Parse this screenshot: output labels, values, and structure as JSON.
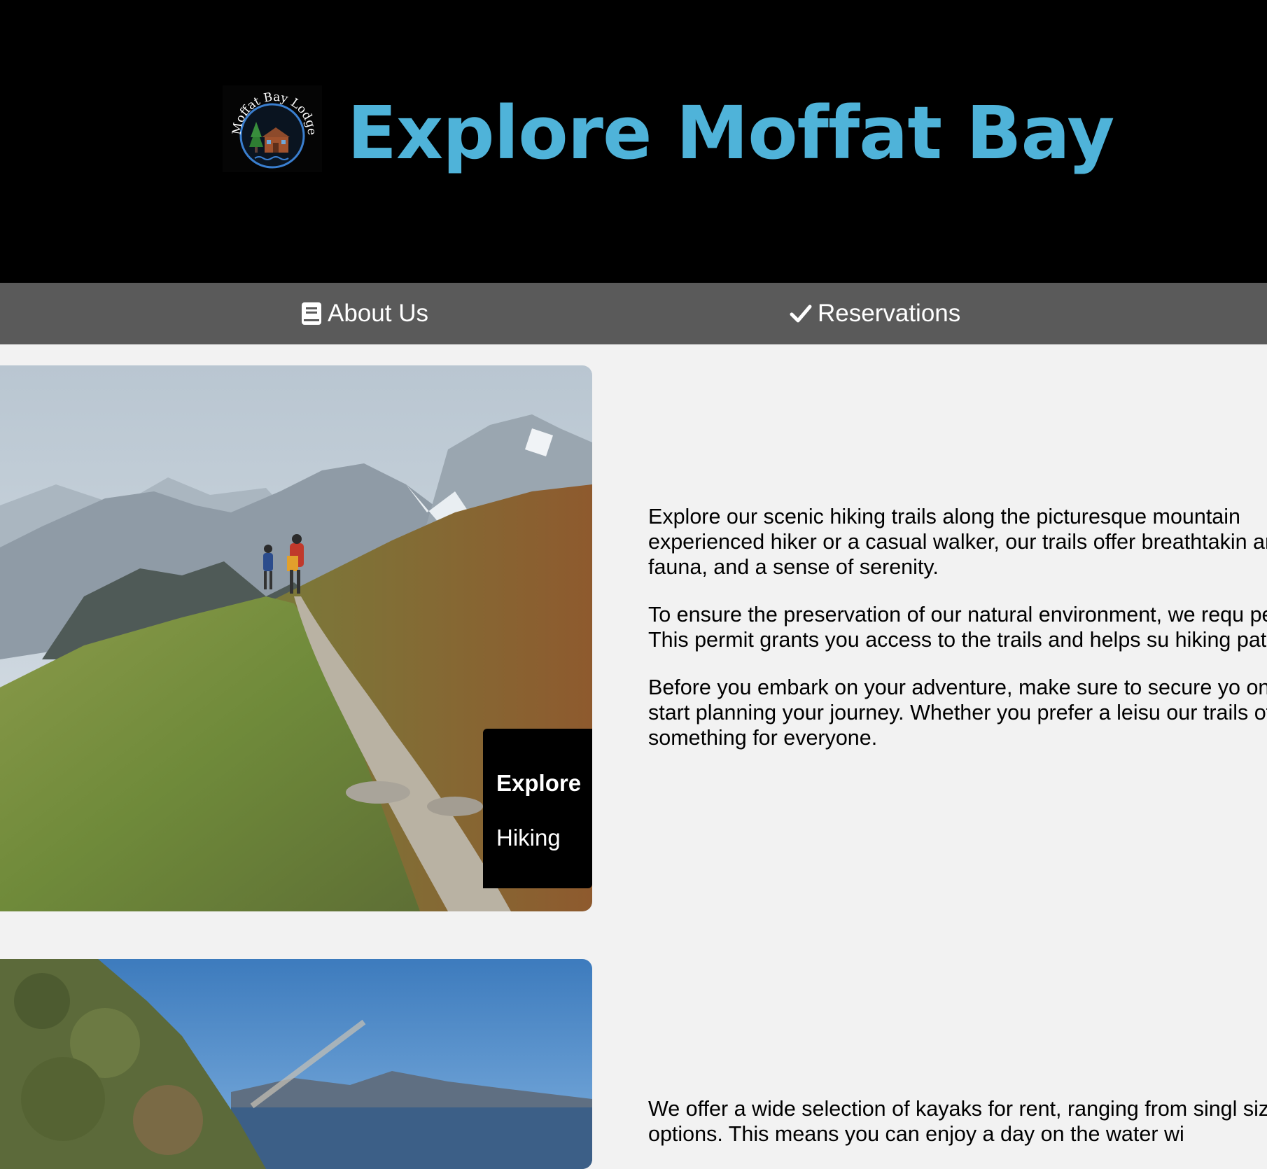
{
  "header": {
    "logo_text": "Moffat Bay Lodge",
    "title": "Explore Moffat Bay",
    "title_color": "#4fb3d9",
    "background": "#000000"
  },
  "nav": {
    "background": "#5a5a5a",
    "items": [
      {
        "label": "About Us",
        "icon": "book-icon"
      },
      {
        "label": "Reservations",
        "icon": "checkmark-icon"
      }
    ]
  },
  "sections": [
    {
      "image": "mountain-hiking-photo",
      "caption_title": "Explore",
      "caption_subtitle": "Hiking",
      "paragraphs": [
        "Explore our scenic hiking trails along the picturesque mountain experienced hiker or a casual walker, our trails offer breathtakin and fauna, and a sense of serenity.",
        "To ensure the preservation of our natural environment, we requ permit. This permit grants you access to the trails and helps su hiking paths.",
        "Before you embark on your adventure, make sure to secure yo one and start planning your journey. Whether you prefer a leisu our trails offer something for everyone."
      ]
    },
    {
      "image": "kayak-bay-photo",
      "paragraphs": [
        "We offer a wide selection of kayaks for rent, ranging from singl sized options. This means you can enjoy a day on the water wi"
      ]
    }
  ]
}
